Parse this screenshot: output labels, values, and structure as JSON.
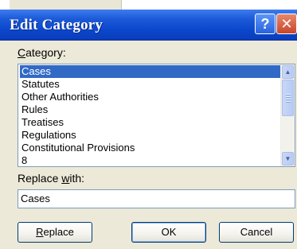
{
  "window": {
    "title": "Edit Category",
    "help_glyph": "?",
    "close_glyph": "✕"
  },
  "category": {
    "label_underlined": "C",
    "label_rest": "ategory:",
    "items": [
      "Cases",
      "Statutes",
      "Other Authorities",
      "Rules",
      "Treatises",
      "Regulations",
      "Constitutional Provisions",
      "8"
    ],
    "selected_index": 0
  },
  "scrollbar": {
    "up_glyph": "▲",
    "down_glyph": "▼"
  },
  "replace_with": {
    "label_before": "Replace ",
    "label_underlined": "w",
    "label_after": "ith:",
    "value": "Cases"
  },
  "buttons": {
    "replace_underlined": "R",
    "replace_rest": "eplace",
    "ok": "OK",
    "cancel": "Cancel"
  },
  "colors": {
    "title_bar": "#0a46cc",
    "selection": "#316ac5",
    "dialog_face": "#ece9d8"
  }
}
